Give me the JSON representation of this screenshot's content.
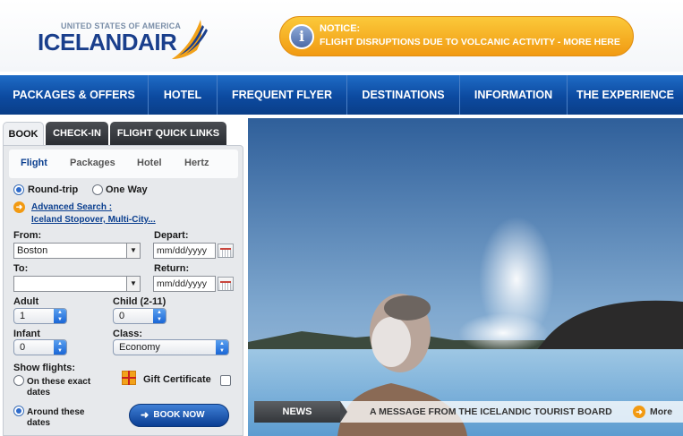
{
  "header": {
    "logo_small": "UNITED STATES OF AMERICA",
    "logo_big": "ICELANDAIR",
    "notice_title": "NOTICE:",
    "notice_text": "FLIGHT DISRUPTIONS DUE TO VOLCANIC ACTIVITY - MORE HERE",
    "notice_icon": "i"
  },
  "nav": {
    "items": [
      "PACKAGES & OFFERS",
      "HOTEL",
      "FREQUENT FLYER",
      "DESTINATIONS",
      "INFORMATION",
      "THE EXPERIENCE"
    ]
  },
  "tabs": [
    "BOOK",
    "CHECK-IN",
    "FLIGHT QUICK LINKS"
  ],
  "subtabs": [
    "Flight",
    "Packages",
    "Hotel",
    "Hertz"
  ],
  "booking": {
    "trip_roundtrip": "Round-trip",
    "trip_oneway": "One Way",
    "advanced_search": "Advanced Search :",
    "advanced_sub": "Iceland Stopover, Multi-City...",
    "from_label": "From:",
    "from_value": "Boston",
    "to_label": "To:",
    "to_value": "",
    "depart_label": "Depart:",
    "depart_value": "mm/dd/yyyy",
    "return_label": "Return:",
    "return_value": "mm/dd/yyyy",
    "adult_label": "Adult",
    "adult_value": "1",
    "child_label": "Child (2-11)",
    "child_value": "0",
    "infant_label": "Infant",
    "infant_value": "0",
    "class_label": "Class:",
    "class_value": "Economy",
    "show_flights_label": "Show flights:",
    "exact_label": "On these exact dates",
    "around_label": "Around these dates",
    "gift_label": "Gift Certificate",
    "book_now": "BOOK NOW"
  },
  "news": {
    "label": "NEWS",
    "text": "A MESSAGE FROM THE ICELANDIC TOURIST BOARD",
    "more": "More"
  },
  "colors": {
    "brand_blue": "#0c4aa0",
    "accent_orange": "#f29a12",
    "link_blue": "#0b3f8f"
  },
  "icons": [
    "info-icon",
    "advanced-search-arrow-icon",
    "calendar-icon",
    "gift-icon",
    "book-arrow-icon",
    "more-arrow-icon",
    "dropdown-arrow-icon",
    "stepper-icon"
  ]
}
